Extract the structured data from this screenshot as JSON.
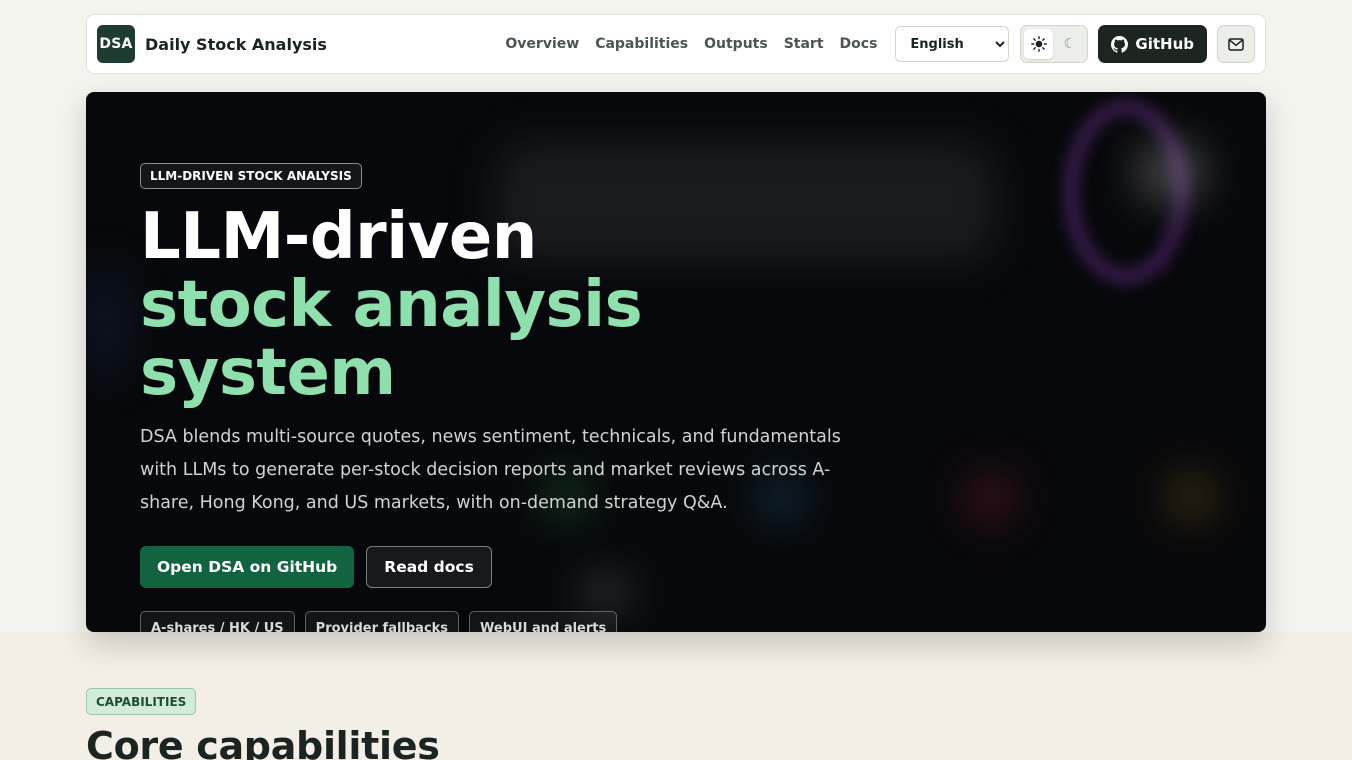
{
  "navbar": {
    "logo_text": "DSA",
    "brand_name": "Daily Stock Analysis",
    "links": [
      "Overview",
      "Capabilities",
      "Outputs",
      "Start",
      "Docs"
    ],
    "language": {
      "selected": "English"
    },
    "theme": {
      "light_icon": "sun-icon",
      "dark_icon": "moon-icon",
      "active": "light"
    },
    "github_label": "GitHub",
    "mail_icon": "mail-icon"
  },
  "hero": {
    "eyebrow": "LLM-DRIVEN STOCK ANALYSIS",
    "headline_line1": "LLM-driven",
    "headline_line2": "stock analysis system",
    "description": "DSA blends multi-source quotes, news sentiment, technicals, and fundamentals with LLMs to generate per-stock decision reports and market reviews across A-share, Hong Kong, and US markets, with on-demand strategy Q&A.",
    "primary_cta": "Open DSA on GitHub",
    "secondary_cta": "Read docs",
    "tags": [
      "A-shares / HK / US",
      "Provider fallbacks",
      "WebUI and alerts"
    ]
  },
  "capabilities": {
    "badge": "CAPABILITIES",
    "title": "Core capabilities"
  },
  "colors": {
    "accent_green": "#126340",
    "headline_green": "#8fe0ae",
    "hero_bg": "#07080b",
    "page_bg": "#f4f4ef"
  }
}
